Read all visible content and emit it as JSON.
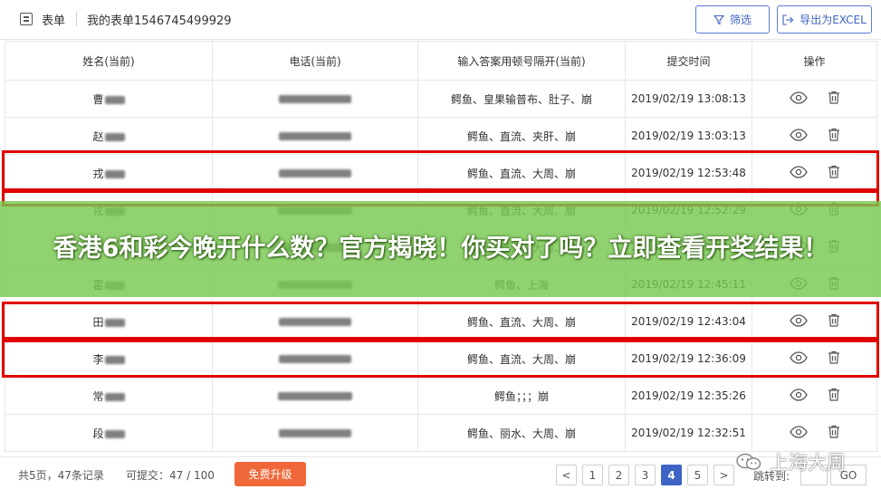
{
  "header": {
    "root_label": "表单",
    "title": "我的表单1546745499929",
    "filter_label": "筛选",
    "export_label": "导出为EXCEL"
  },
  "table": {
    "columns": [
      "姓名(当前)",
      "电话(当前)",
      "输入答案用顿号隔开(当前)",
      "提交时间",
      "操作"
    ],
    "rows": [
      {
        "name": "曹",
        "answer": "鳄鱼、皇果输普布、肚子、崩",
        "time": "2019/02/19 13:08:13"
      },
      {
        "name": "赵",
        "answer": "鳄鱼、直流、夹肝、崩",
        "time": "2019/02/19 13:03:13"
      },
      {
        "name": "戎",
        "answer": "鳄鱼、直流、大周、崩",
        "time": "2019/02/19 12:53:48"
      },
      {
        "name": "戎",
        "answer": "鳄鱼、直流、大周、崩",
        "time": "2019/02/19 12:52:29"
      },
      {
        "name": "黄",
        "answer": "鳄鱼、直流、大周、崩",
        "time": "2019/02/19 12:46:35"
      },
      {
        "name": "霍",
        "answer": "鳄鱼、上海",
        "time": "2019/02/19 12:45:11"
      },
      {
        "name": "田",
        "answer": "鳄鱼、直流、大周、崩",
        "time": "2019/02/19 12:43:04"
      },
      {
        "name": "李",
        "answer": "鳄鱼、直流、大周、崩",
        "time": "2019/02/19 12:36:09"
      },
      {
        "name": "常",
        "answer": "鳄鱼；；；崩",
        "time": "2019/02/19 12:35:26"
      },
      {
        "name": "段",
        "answer": "鳄鱼、丽水、大周、崩",
        "time": "2019/02/19 12:32:51"
      }
    ]
  },
  "banner": {
    "text": "香港6和彩今晚开什么数？官方揭晓！你买对了吗？立即查看开奖结果！"
  },
  "footer": {
    "total": "共5页，47条记录",
    "quota": "可提交：47 / 100",
    "upgrade_label": "免费升级",
    "pages": [
      "<",
      "1",
      "2",
      "3",
      "4",
      "5",
      ">"
    ],
    "active_page": "4",
    "jump_label": "跳转到:",
    "go_label": "GO"
  },
  "watermark": {
    "text": "上海大周"
  },
  "colors": {
    "accent": "#3f63c4",
    "highlight_border": "#e00000",
    "banner_bg": "#78c850",
    "upgrade_bg": "#f0683a"
  }
}
